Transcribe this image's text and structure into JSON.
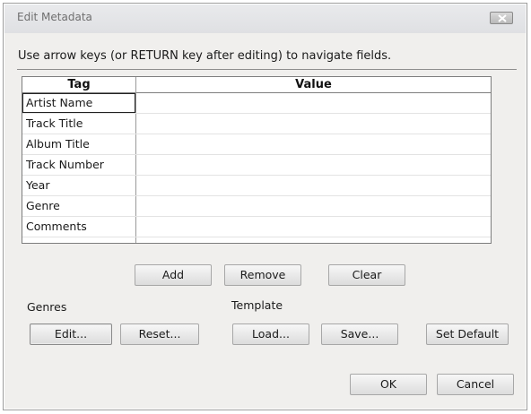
{
  "window": {
    "title": "Edit Metadata"
  },
  "instructions": "Use arrow keys (or RETURN key after editing) to navigate fields.",
  "table": {
    "columns": [
      "Tag",
      "Value"
    ],
    "rows": [
      {
        "tag": "Artist Name",
        "value": ""
      },
      {
        "tag": "Track Title",
        "value": ""
      },
      {
        "tag": "Album Title",
        "value": ""
      },
      {
        "tag": "Track Number",
        "value": ""
      },
      {
        "tag": "Year",
        "value": ""
      },
      {
        "tag": "Genre",
        "value": ""
      },
      {
        "tag": "Comments",
        "value": ""
      },
      {
        "tag": "",
        "value": ""
      }
    ]
  },
  "row_buttons": {
    "add": "Add",
    "remove": "Remove",
    "clear": "Clear"
  },
  "genres": {
    "label": "Genres",
    "edit": "Edit...",
    "reset": "Reset..."
  },
  "template": {
    "label": "Template",
    "load": "Load...",
    "save": "Save...",
    "set_default": "Set Default"
  },
  "dialog_buttons": {
    "ok": "OK",
    "cancel": "Cancel"
  }
}
